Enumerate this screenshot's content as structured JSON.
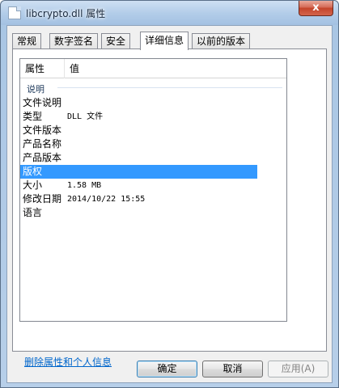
{
  "window": {
    "title": "libcrypto.dll 属性",
    "close_label": "x"
  },
  "tabs": [
    {
      "label": "常规"
    },
    {
      "label": "数字签名"
    },
    {
      "label": "安全"
    },
    {
      "label": "详细信息",
      "active": true
    },
    {
      "label": "以前的版本"
    }
  ],
  "details": {
    "header": {
      "property": "属性",
      "value": "值"
    },
    "group_label": "说明",
    "rows": [
      {
        "key": "文件说明",
        "value": ""
      },
      {
        "key": "类型",
        "value": "DLL 文件"
      },
      {
        "key": "文件版本",
        "value": ""
      },
      {
        "key": "产品名称",
        "value": ""
      },
      {
        "key": "产品版本",
        "value": ""
      },
      {
        "key": "版权",
        "value": "",
        "selected": true
      },
      {
        "key": "大小",
        "value": "1.58 MB"
      },
      {
        "key": "修改日期",
        "value": "2014/10/22 15:55"
      },
      {
        "key": "语言",
        "value": ""
      }
    ]
  },
  "link": {
    "label": "删除属性和个人信息"
  },
  "buttons": {
    "ok": "确定",
    "cancel": "取消",
    "apply": "应用(A)"
  },
  "colors": {
    "selection": "#3399ff",
    "link": "#0066cc"
  }
}
